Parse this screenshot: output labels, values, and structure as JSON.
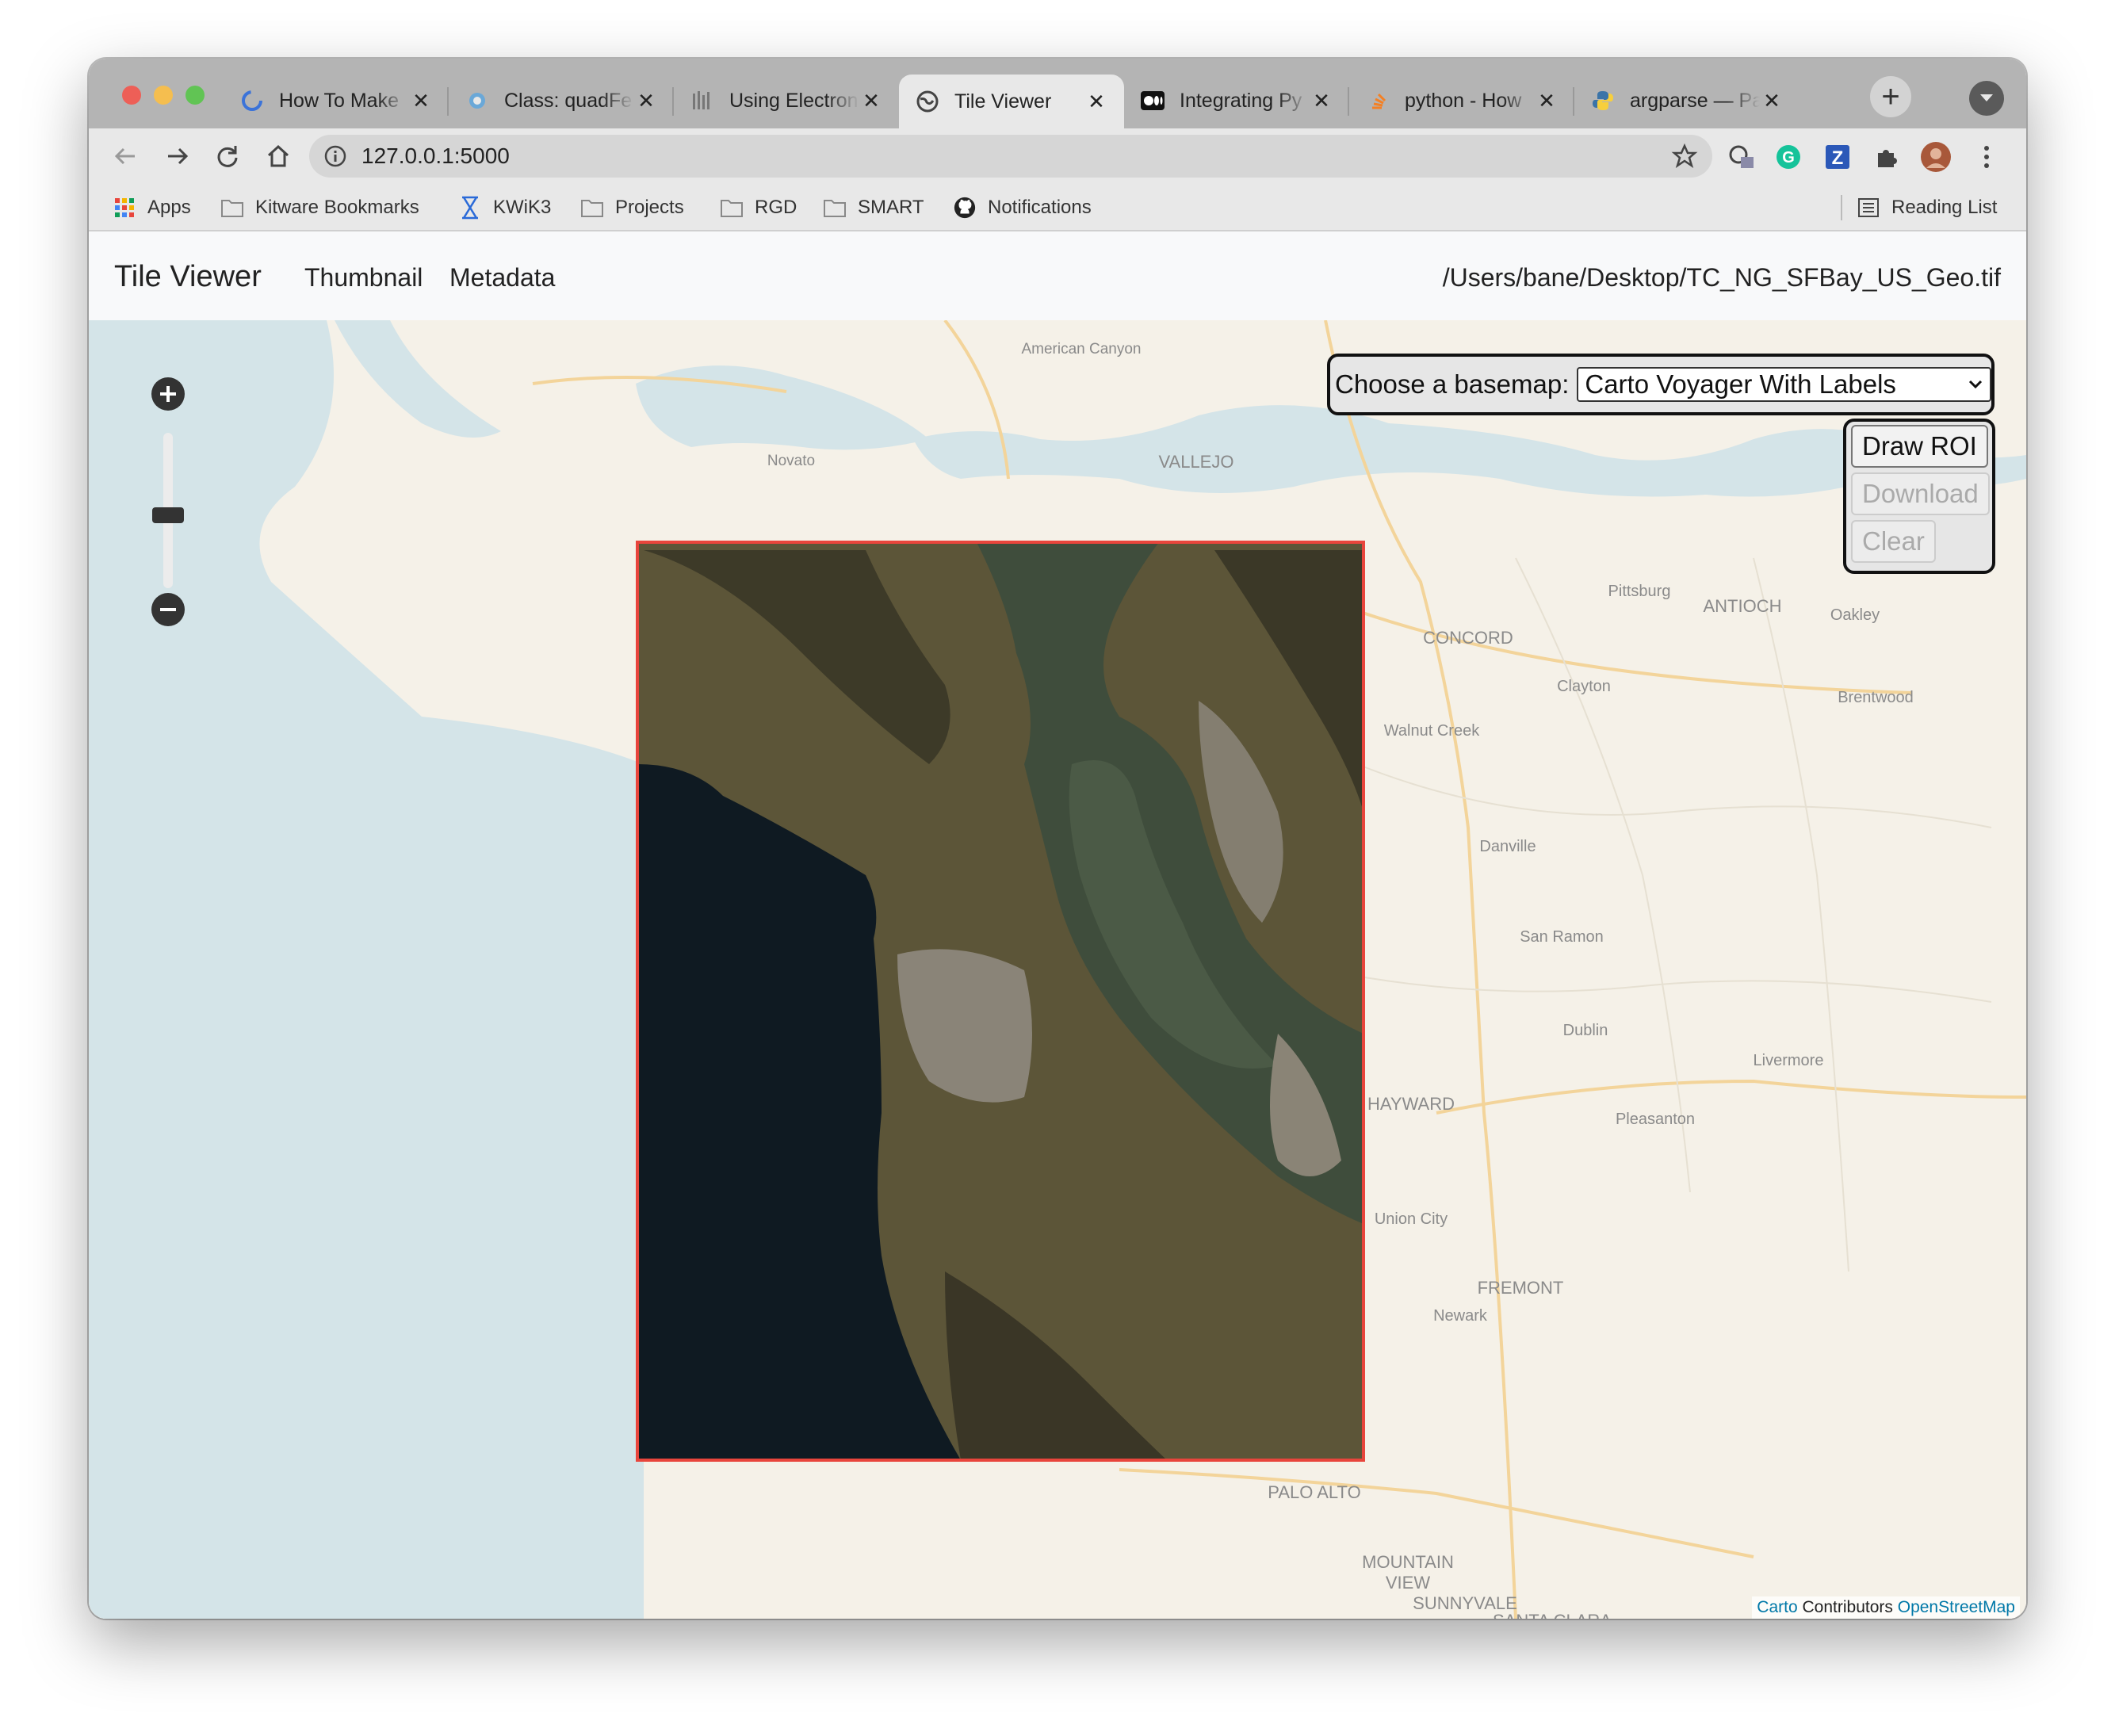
{
  "browser": {
    "tabs": [
      {
        "title": "How To Make",
        "icon": "loading-icon"
      },
      {
        "title": "Class: quadFe",
        "icon": "gear-icon"
      },
      {
        "title": "Using Electron",
        "icon": "bars-icon"
      },
      {
        "title": "Tile Viewer",
        "icon": "globe-icon",
        "active": true
      },
      {
        "title": "Integrating Py",
        "icon": "medium-icon"
      },
      {
        "title": "python - How",
        "icon": "stackoverflow-icon"
      },
      {
        "title": "argparse — Pa",
        "icon": "python-icon"
      }
    ],
    "close_glyph": "✕",
    "url": "127.0.0.1:5000",
    "bookmarks": [
      {
        "label": "Apps",
        "icon": "apps-grid-icon"
      },
      {
        "label": "Kitware Bookmarks",
        "icon": "folder-icon"
      },
      {
        "label": "KWiK3",
        "icon": "hourglass-icon"
      },
      {
        "label": "Projects",
        "icon": "folder-icon"
      },
      {
        "label": "RGD",
        "icon": "folder-icon"
      },
      {
        "label": "SMART",
        "icon": "folder-icon"
      },
      {
        "label": "Notifications",
        "icon": "github-icon"
      }
    ],
    "reading_list": "Reading List"
  },
  "app": {
    "brand": "Tile Viewer",
    "nav": [
      "Thumbnail",
      "Metadata"
    ],
    "file_path": "/Users/bane/Desktop/TC_NG_SFBay_US_Geo.tif"
  },
  "map": {
    "basemap_label": "Choose a basemap:",
    "basemap_selected": "Carto Voyager With Labels",
    "roi": {
      "draw": "Draw ROI",
      "download": "Download",
      "clear": "Clear"
    },
    "attribution": {
      "carto": "Carto",
      "contributors": "Contributors",
      "osm": "OpenStreetMap"
    },
    "place_labels": [
      "American Canyon",
      "Novato",
      "VALLEJO",
      "Pittsburg",
      "ANTIOCH",
      "Oakley",
      "CONCORD",
      "Clayton",
      "Brentwood",
      "Walnut Creek",
      "Danville",
      "San Ramon",
      "Dublin",
      "Livermore",
      "HAYWARD",
      "Pleasanton",
      "Union City",
      "FREMONT",
      "Newark",
      "PALO ALTO",
      "MOUNTAIN",
      "VIEW",
      "SUNNYVALE",
      "SANTA CLARA"
    ],
    "colors": {
      "overlay_border": "#e8453c",
      "water": "#d4e4e8",
      "land": "#f5f1e8"
    }
  }
}
